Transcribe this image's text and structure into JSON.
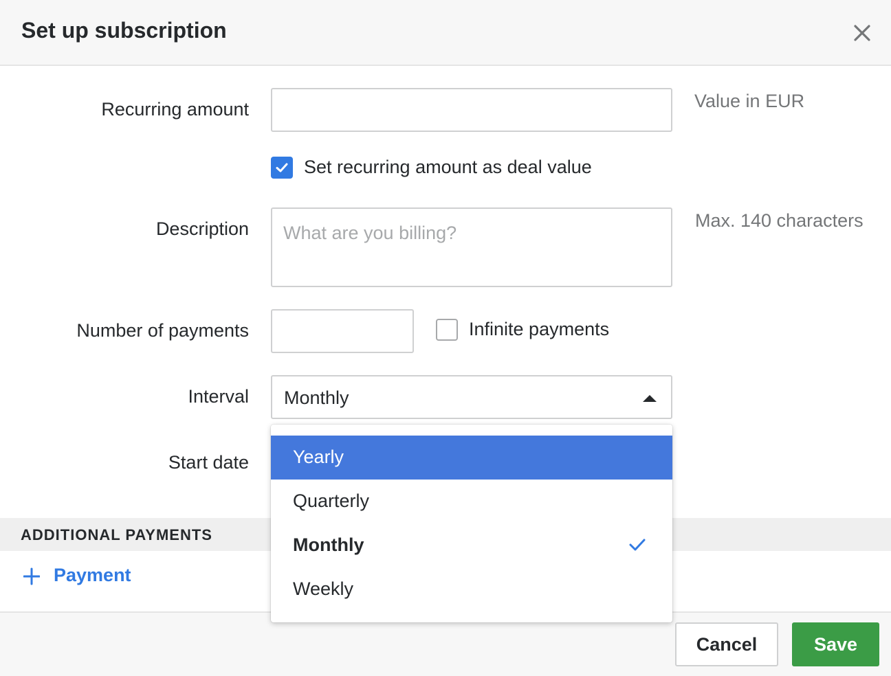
{
  "dialog": {
    "title": "Set up subscription"
  },
  "form": {
    "recurring_amount": {
      "label": "Recurring amount",
      "value": "",
      "hint": "Value in EUR"
    },
    "deal_value_checkbox": {
      "label": "Set recurring amount as deal value",
      "checked": true
    },
    "description": {
      "label": "Description",
      "value": "",
      "placeholder": "What are you billing?",
      "hint": "Max. 140 characters"
    },
    "number_of_payments": {
      "label": "Number of payments",
      "value": ""
    },
    "infinite_checkbox": {
      "label": "Infinite payments",
      "checked": false
    },
    "interval": {
      "label": "Interval",
      "value": "Monthly"
    },
    "start_date": {
      "label": "Start date"
    }
  },
  "dropdown": {
    "options": [
      "Yearly",
      "Quarterly",
      "Monthly",
      "Weekly"
    ],
    "highlighted": "Yearly",
    "selected": "Monthly"
  },
  "additional_payments": {
    "section_title": "ADDITIONAL PAYMENTS",
    "add_label": "Payment"
  },
  "footer": {
    "cancel_label": "Cancel",
    "save_label": "Save"
  },
  "colors": {
    "accent": "#317ae2",
    "highlight": "#4478dc",
    "save": "#3b9c46"
  }
}
